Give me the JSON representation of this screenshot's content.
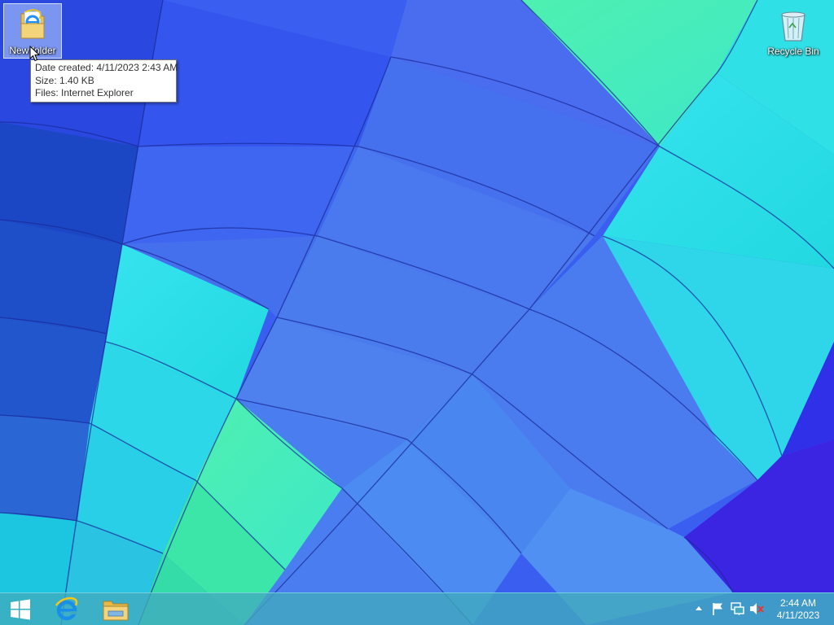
{
  "desktop": {
    "icons": [
      {
        "label": "New folder",
        "icon": "folder-with-ie-icon",
        "selected": true
      },
      {
        "label": "Recycle Bin",
        "icon": "recycle-bin-icon",
        "selected": false
      }
    ],
    "tooltip": {
      "date_created": "Date created: 4/11/2023 2:43 AM",
      "size": "Size: 1.40 KB",
      "files": "Files: Internet Explorer"
    }
  },
  "taskbar": {
    "start_icon": "windows-logo-icon",
    "pinned": [
      {
        "name": "Internet Explorer",
        "icon": "internet-explorer-icon"
      },
      {
        "name": "File Explorer",
        "icon": "file-explorer-icon"
      }
    ],
    "tray": {
      "icons": [
        "show-hidden-icons-chevron",
        "action-center-flag-icon",
        "network-icon",
        "volume-muted-icon"
      ]
    },
    "clock": {
      "time": "2:44 AM",
      "date": "4/11/2023"
    }
  },
  "colors": {
    "taskbar": "#41aabe",
    "wallpaper_blue": "#3f66e8",
    "wallpaper_cyan": "#2ee6e6",
    "wallpaper_green": "#4cf0a6",
    "wallpaper_violet": "#3a22e0",
    "tooltip_bg": "#ffffff"
  }
}
